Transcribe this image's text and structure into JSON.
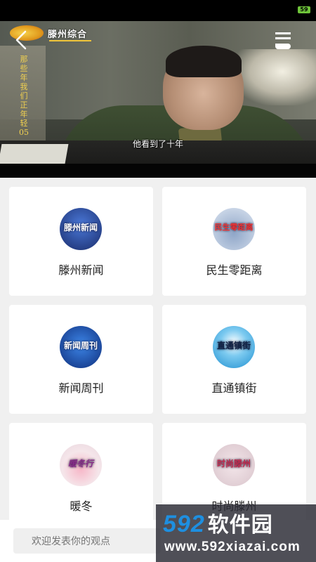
{
  "status_bar": {
    "battery_icon": "battery-icon",
    "battery_text": "59",
    "battery_color": "#6ec33a"
  },
  "player": {
    "channel_name": "滕州综合",
    "vertical_caption": "那些年我们正年轻05",
    "subtitle": "他看到了十年",
    "back_icon": "chevron-left-icon",
    "menu_icon": "menu-icon"
  },
  "programs": [
    {
      "label": "滕州新闻",
      "thumb_text": "滕州新闻",
      "thumb_color": "#1f3b8a"
    },
    {
      "label": "民生零距离",
      "thumb_text": "民生零距离",
      "thumb_color": "#b7c8e2"
    },
    {
      "label": "新闻周刊",
      "thumb_text": "新闻周刊",
      "thumb_color": "#1b4fb0"
    },
    {
      "label": "直通镇街",
      "thumb_text": "直通镇街",
      "thumb_color": "#3aa3d8"
    },
    {
      "label": "暖冬",
      "thumb_text": "暖冬行",
      "thumb_color": "#f3e9ef"
    },
    {
      "label": "时尚滕州",
      "thumb_text": "时尚滕州",
      "thumb_color": "#e8dcdf"
    }
  ],
  "comment": {
    "placeholder": "欢迎发表你的观点"
  },
  "watermark": {
    "brand_num": "592",
    "brand_cn": "软件园",
    "url": "www.592xiazai.com"
  },
  "colors": {
    "background": "#f0f0f0",
    "card": "#ffffff",
    "watermark_blue": "#1e8fe0"
  }
}
